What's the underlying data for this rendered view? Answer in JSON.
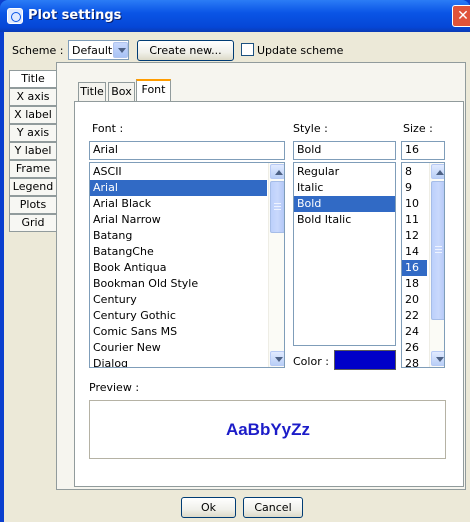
{
  "window": {
    "title": "Plot settings",
    "close_glyph": "✕"
  },
  "scheme": {
    "label": "Scheme :",
    "value": "Default",
    "create_new": "Create new...",
    "update_label": "Update scheme"
  },
  "side_tabs": [
    "Title",
    "X axis",
    "X label",
    "Y axis",
    "Y label",
    "Frame",
    "Legend",
    "Plots",
    "Grid"
  ],
  "inner_tabs": [
    "Title",
    "Box",
    "Font"
  ],
  "font": {
    "label": "Font :",
    "value": "Arial",
    "items": [
      "ASCII",
      "Arial",
      "Arial Black",
      "Arial Narrow",
      "Batang",
      "BatangChe",
      "Book Antiqua",
      "Bookman Old Style",
      "Century",
      "Century Gothic",
      "Comic Sans MS",
      "Courier New",
      "Dialog"
    ],
    "selected": "Arial"
  },
  "style": {
    "label": "Style :",
    "value": "Bold",
    "items": [
      "Regular",
      "Italic",
      "Bold",
      "Bold Italic"
    ],
    "selected": "Bold"
  },
  "size": {
    "label": "Size :",
    "value": "16",
    "items": [
      "8",
      "9",
      "10",
      "11",
      "12",
      "14",
      "16",
      "18",
      "20",
      "22",
      "24",
      "26",
      "28"
    ],
    "selected": "16"
  },
  "color": {
    "label": "Color :",
    "value": "#0000c8"
  },
  "preview": {
    "label": "Preview :",
    "text": "AaBbYyZz",
    "color": "#1c1cc8"
  },
  "buttons": {
    "ok": "Ok",
    "cancel": "Cancel"
  },
  "icons": {
    "app": "plot-settings-icon",
    "close": "close-icon"
  }
}
